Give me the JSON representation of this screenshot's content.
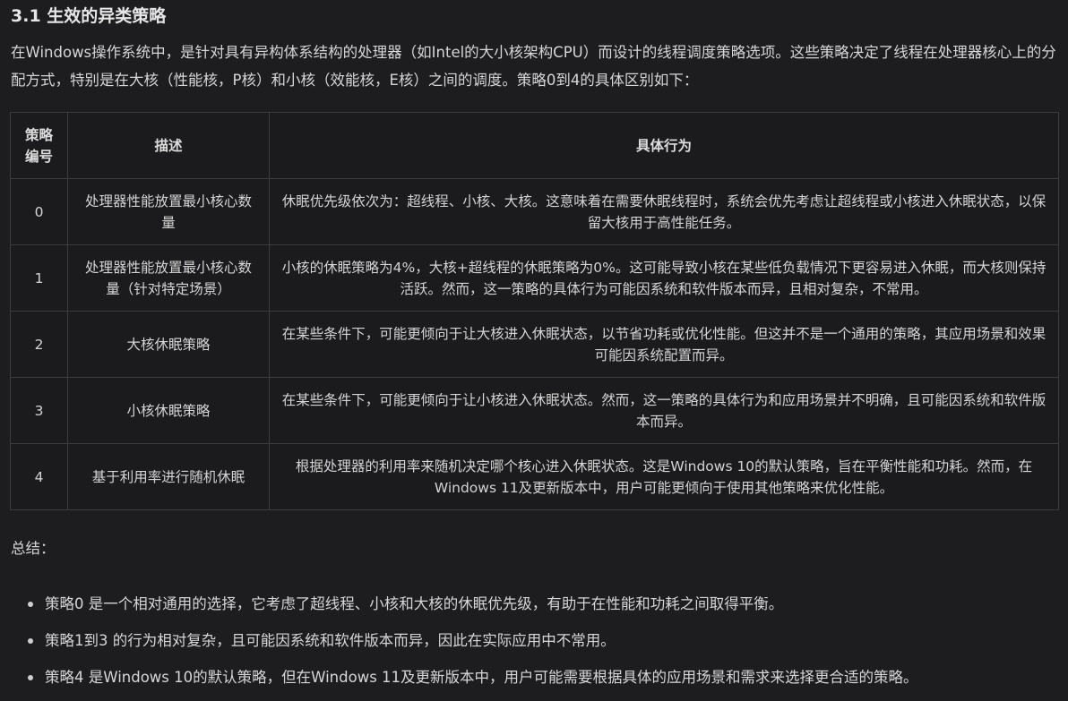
{
  "section": {
    "heading": "3.1 生效的异类策略",
    "intro": "在Windows操作系统中，是针对具有异构体系结构的处理器（如Intel的大小核架构CPU）而设计的线程调度策略选项。这些策略决定了线程在处理器核心上的分配方式，特别是在大核（性能核，P核）和小核（效能核，E核）之间的调度。策略0到4的具体区别如下："
  },
  "table": {
    "headers": {
      "id": "策略编号",
      "desc": "描述",
      "behavior": "具体行为"
    },
    "rows": [
      {
        "id": "0",
        "desc": "处理器性能放置最小核心数量",
        "behavior": "休眠优先级依次为：超线程、小核、大核。这意味着在需要休眠线程时，系统会优先考虑让超线程或小核进入休眠状态，以保留大核用于高性能任务。"
      },
      {
        "id": "1",
        "desc": "处理器性能放置最小核心数量（针对特定场景）",
        "behavior": "小核的休眠策略为4%，大核+超线程的休眠策略为0%。这可能导致小核在某些低负载情况下更容易进入休眠，而大核则保持活跃。然而，这一策略的具体行为可能因系统和软件版本而异，且相对复杂，不常用。"
      },
      {
        "id": "2",
        "desc": "大核休眠策略",
        "behavior": "在某些条件下，可能更倾向于让大核进入休眠状态，以节省功耗或优化性能。但这并不是一个通用的策略，其应用场景和效果可能因系统配置而异。"
      },
      {
        "id": "3",
        "desc": "小核休眠策略",
        "behavior": "在某些条件下，可能更倾向于让小核进入休眠状态。然而，这一策略的具体行为和应用场景并不明确，且可能因系统和软件版本而异。"
      },
      {
        "id": "4",
        "desc": "基于利用率进行随机休眠",
        "behavior": "根据处理器的利用率来随机决定哪个核心进入休眠状态。这是Windows 10的默认策略，旨在平衡性能和功耗。然而，在Windows 11及更新版本中，用户可能更倾向于使用其他策略来优化性能。"
      }
    ]
  },
  "summary": {
    "label": "总结：",
    "points": [
      "策略0 是一个相对通用的选择，它考虑了超线程、小核和大核的休眠优先级，有助于在性能和功耗之间取得平衡。",
      "策略1到3 的行为相对复杂，且可能因系统和软件版本而异，因此在实际应用中不常用。",
      "策略4 是Windows 10的默认策略，但在Windows 11及更新版本中，用户可能需要根据具体的应用场景和需求来选择更合适的策略。"
    ]
  }
}
